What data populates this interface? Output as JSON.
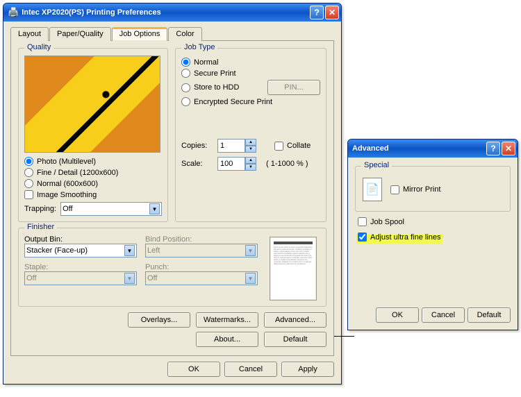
{
  "main": {
    "title": "Intec XP2020(PS) Printing Preferences",
    "tabs": [
      "Layout",
      "Paper/Quality",
      "Job Options",
      "Color"
    ],
    "active_tab": 2,
    "quality": {
      "legend": "Quality",
      "options": [
        "Photo (Multilevel)",
        "Fine / Detail (1200x600)",
        "Normal (600x600)"
      ],
      "selected": 0,
      "smoothing": "Image Smoothing",
      "trapping_label": "Trapping:",
      "trapping_value": "Off"
    },
    "jobtype": {
      "legend": "Job Type",
      "options": [
        "Normal",
        "Secure Print",
        "Store to HDD",
        "Encrypted Secure Print"
      ],
      "selected": 0,
      "pin": "PIN...",
      "copies_label": "Copies:",
      "copies_value": "1",
      "collate": "Collate",
      "scale_label": "Scale:",
      "scale_value": "100",
      "scale_range": "( 1-1000 % )"
    },
    "finisher": {
      "legend": "Finisher",
      "output_bin_label": "Output Bin:",
      "output_bin_value": "Stacker (Face-up)",
      "bind_label": "Bind Position:",
      "bind_value": "Left",
      "staple_label": "Staple:",
      "staple_value": "Off",
      "punch_label": "Punch:",
      "punch_value": "Off"
    },
    "buttons": {
      "overlays": "Overlays...",
      "watermarks": "Watermarks...",
      "advanced": "Advanced...",
      "about": "About...",
      "default": "Default"
    },
    "footer": {
      "ok": "OK",
      "cancel": "Cancel",
      "apply": "Apply"
    }
  },
  "adv": {
    "title": "Advanced",
    "special_legend": "Special",
    "mirror": "Mirror Print",
    "job_spool": "Job Spool",
    "adjust_lines": "Adjust ultra fine lines",
    "ok": "OK",
    "cancel": "Cancel",
    "default": "Default"
  }
}
